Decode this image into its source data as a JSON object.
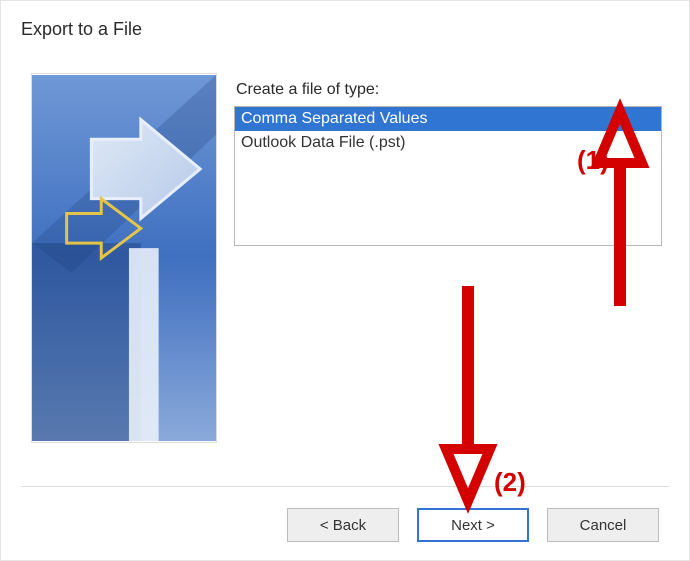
{
  "dialog": {
    "title": "Export to a File",
    "instruction": "Create a file of type:",
    "file_types": [
      {
        "label": "Comma Separated Values",
        "selected": true
      },
      {
        "label": "Outlook Data File (.pst)",
        "selected": false
      }
    ],
    "buttons": {
      "back": "< Back",
      "next": "Next >",
      "cancel": "Cancel"
    }
  },
  "annotations": {
    "label1": "(1)",
    "label2": "(2)",
    "color": "#d40000"
  }
}
